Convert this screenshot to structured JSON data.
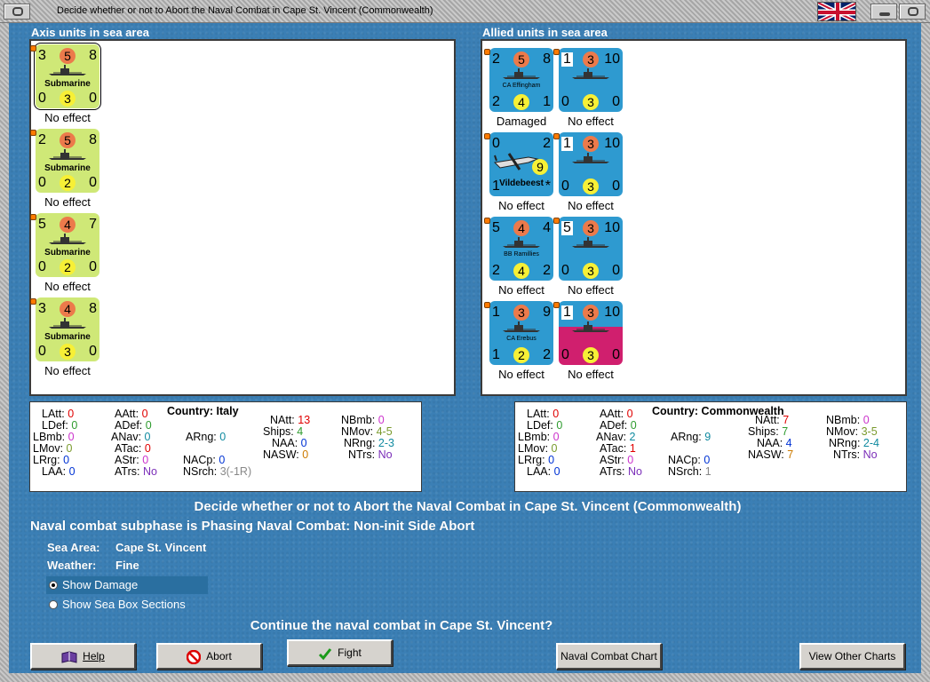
{
  "window": {
    "title": "Decide whether or not to Abort the Naval Combat in Cape St. Vincent (Commonwealth)"
  },
  "axis": {
    "header": "Axis units in sea area",
    "units": [
      {
        "tl": "3",
        "circle": "5",
        "tr": "8",
        "name": "Submarine",
        "bl": "0",
        "bc": "3",
        "br": "0",
        "status": "No effect"
      },
      {
        "tl": "2",
        "circle": "5",
        "tr": "8",
        "name": "Submarine",
        "bl": "0",
        "bc": "2",
        "br": "0",
        "status": "No effect"
      },
      {
        "tl": "5",
        "circle": "4",
        "tr": "7",
        "name": "Submarine",
        "bl": "0",
        "bc": "2",
        "br": "0",
        "status": "No effect"
      },
      {
        "tl": "3",
        "circle": "4",
        "tr": "8",
        "name": "Submarine",
        "bl": "0",
        "bc": "3",
        "br": "0",
        "status": "No effect"
      }
    ]
  },
  "allied": {
    "header": "Allied units in sea area",
    "units": [
      {
        "tl": "2",
        "circle": "5",
        "tr": "8",
        "name": "CA Effingham",
        "bl": "2",
        "bc": "4",
        "br": "1",
        "status": "Damaged"
      },
      {
        "tl": "1",
        "circle": "3",
        "tr": "10",
        "name": "",
        "bl": "0",
        "bc": "3",
        "br": "0",
        "status": "No effect"
      },
      {
        "tl": "0",
        "circle": "",
        "tr": "2",
        "name": "Vildebeest",
        "bl": "1",
        "bc": "9",
        "br": "*",
        "status": "No effect"
      },
      {
        "tl": "1",
        "circle": "3",
        "tr": "10",
        "name": "",
        "bl": "0",
        "bc": "3",
        "br": "0",
        "status": "No effect"
      },
      {
        "tl": "5",
        "circle": "4",
        "tr": "4",
        "name": "BB Ramillies",
        "bl": "2",
        "bc": "4",
        "br": "2",
        "status": "No effect"
      },
      {
        "tl": "5",
        "circle": "3",
        "tr": "10",
        "name": "",
        "bl": "0",
        "bc": "3",
        "br": "0",
        "status": "No effect"
      },
      {
        "tl": "1",
        "circle": "3",
        "tr": "9",
        "name": "CA Erebus",
        "bl": "1",
        "bc": "2",
        "br": "2",
        "status": "No effect"
      },
      {
        "tl": "1",
        "circle": "3",
        "tr": "10",
        "name": "",
        "bl": "0",
        "bc": "3",
        "br": "0",
        "status": "No effect"
      }
    ]
  },
  "stats_italy": {
    "country_label": "Country: Italy",
    "latt": {
      "k": "LAtt:",
      "v": "0"
    },
    "ldef": {
      "k": "LDef:",
      "v": "0"
    },
    "lbmb": {
      "k": "LBmb:",
      "v": "0"
    },
    "lmov": {
      "k": "LMov:",
      "v": "0"
    },
    "lrrg": {
      "k": "LRrg:",
      "v": "0"
    },
    "laa": {
      "k": "LAA:",
      "v": "0"
    },
    "aatt": {
      "k": "AAtt:",
      "v": "0"
    },
    "adef": {
      "k": "ADef:",
      "v": "0"
    },
    "anav": {
      "k": "ANav:",
      "v": "0"
    },
    "atac": {
      "k": "ATac:",
      "v": "0"
    },
    "astr": {
      "k": "AStr:",
      "v": "0"
    },
    "atrs": {
      "k": "ATrs:",
      "v": "No"
    },
    "arng": {
      "k": "ARng:",
      "v": "0"
    },
    "nacp": {
      "k": "NACp:",
      "v": "0"
    },
    "nsrch": {
      "k": "NSrch:",
      "v": "3(-1R)"
    },
    "natt": {
      "k": "NAtt:",
      "v": "13"
    },
    "ships": {
      "k": "Ships:",
      "v": "4"
    },
    "naa": {
      "k": "NAA:",
      "v": "0"
    },
    "nasw": {
      "k": "NASW:",
      "v": "0"
    },
    "nbmb": {
      "k": "NBmb:",
      "v": "0"
    },
    "nmov": {
      "k": "NMov:",
      "v": "4-5"
    },
    "nrng": {
      "k": "NRng:",
      "v": "2-3"
    },
    "ntrs": {
      "k": "NTrs:",
      "v": "No"
    }
  },
  "stats_cw": {
    "country_label": "Country: Commonwealth",
    "latt": {
      "k": "LAtt:",
      "v": "0"
    },
    "ldef": {
      "k": "LDef:",
      "v": "0"
    },
    "lbmb": {
      "k": "LBmb:",
      "v": "0"
    },
    "lmov": {
      "k": "LMov:",
      "v": "0"
    },
    "lrrg": {
      "k": "LRrg:",
      "v": "0"
    },
    "laa": {
      "k": "LAA:",
      "v": "0"
    },
    "aatt": {
      "k": "AAtt:",
      "v": "0"
    },
    "adef": {
      "k": "ADef:",
      "v": "0"
    },
    "anav": {
      "k": "ANav:",
      "v": "2"
    },
    "atac": {
      "k": "ATac:",
      "v": "1"
    },
    "astr": {
      "k": "AStr:",
      "v": "0"
    },
    "atrs": {
      "k": "ATrs:",
      "v": "No"
    },
    "arng": {
      "k": "ARng:",
      "v": "9"
    },
    "nacp": {
      "k": "NACp:",
      "v": "0"
    },
    "nsrch": {
      "k": "NSrch:",
      "v": "1"
    },
    "natt": {
      "k": "NAtt:",
      "v": "7"
    },
    "ships": {
      "k": "Ships:",
      "v": "7"
    },
    "naa": {
      "k": "NAA:",
      "v": "4"
    },
    "nasw": {
      "k": "NASW:",
      "v": "7"
    },
    "nbmb": {
      "k": "NBmb:",
      "v": "0"
    },
    "nmov": {
      "k": "NMov:",
      "v": "3-5"
    },
    "nrng": {
      "k": "NRng:",
      "v": "2-4"
    },
    "ntrs": {
      "k": "NTrs:",
      "v": "No"
    }
  },
  "info": {
    "heading": "Decide whether or not to Abort the Naval Combat in Cape St. Vincent (Commonwealth)",
    "subphase": "Naval combat subphase is Phasing Naval Combat: Non-init Side Abort",
    "sea_area_label": "Sea Area:",
    "sea_area_value": "Cape St. Vincent",
    "weather_label": "Weather:",
    "weather_value": "Fine",
    "question": "Continue the naval combat in Cape St. Vincent?"
  },
  "options": {
    "show_damage": "Show Damage",
    "show_sea_box": "Show Sea Box Sections",
    "selected": "Show Damage"
  },
  "buttons": {
    "help": "Help",
    "abort": "Abort",
    "fight": "Fight",
    "naval_chart": "Naval Combat Chart",
    "other_charts": "View Other Charts"
  },
  "icons": {
    "help": "book-icon",
    "abort": "no-entry-icon",
    "fight": "checkmark-icon",
    "flag": "union-jack-icon"
  },
  "colors": {
    "axis_counter": "#cfe877",
    "allied_counter": "#2e9ad0",
    "allied_alt_counter": "#d01f6e",
    "attack_circle": "#ec7a4b",
    "defense_circle": "#f7f036",
    "sea_background": "#3b7fb5"
  }
}
